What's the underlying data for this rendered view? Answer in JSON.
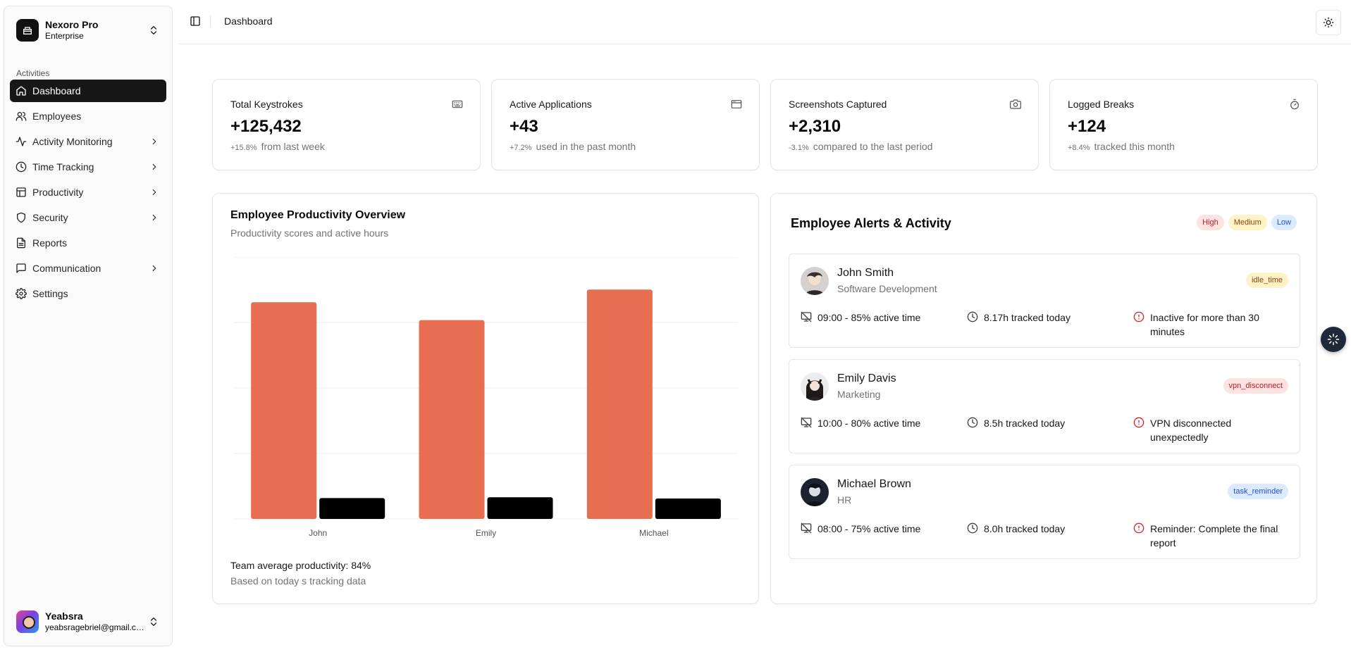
{
  "sidebar": {
    "brand": {
      "name": "Nexoro Pro",
      "plan": "Enterprise"
    },
    "section_label": "Activities",
    "items": [
      {
        "label": "Dashboard",
        "icon": "home-icon",
        "active": true
      },
      {
        "label": "Employees",
        "icon": "users-icon"
      },
      {
        "label": "Activity Monitoring",
        "icon": "activity-icon",
        "has_children": true
      },
      {
        "label": "Time Tracking",
        "icon": "clock-icon",
        "has_children": true
      },
      {
        "label": "Productivity",
        "icon": "table-icon",
        "has_children": true
      },
      {
        "label": "Security",
        "icon": "shield-icon",
        "has_children": true
      },
      {
        "label": "Reports",
        "icon": "file-text-icon"
      },
      {
        "label": "Communication",
        "icon": "message-icon",
        "has_children": true
      },
      {
        "label": "Settings",
        "icon": "gear-icon"
      }
    ],
    "user": {
      "name": "Yeabsra",
      "email": "yeabsragebriel@gmail.com"
    }
  },
  "header": {
    "title": "Dashboard"
  },
  "stats": [
    {
      "title": "Total Keystrokes",
      "value": "+125,432",
      "delta": "+15.8%",
      "note": "from last week",
      "icon": "keyboard-icon"
    },
    {
      "title": "Active Applications",
      "value": "+43",
      "delta": "+7.2%",
      "note": "used in the past month",
      "icon": "app-window-icon"
    },
    {
      "title": "Screenshots Captured",
      "value": "+2,310",
      "delta": "-3.1%",
      "note": "compared to the last period",
      "icon": "camera-icon"
    },
    {
      "title": "Logged Breaks",
      "value": "+124",
      "delta": "+8.4%",
      "note": "tracked this month",
      "icon": "timer-icon"
    }
  ],
  "productivity": {
    "title": "Employee Productivity Overview",
    "subtitle": "Productivity scores and active hours",
    "footer_main": "Team average productivity: 84%",
    "footer_sub": "Based on today s tracking data"
  },
  "chart_data": {
    "type": "bar",
    "title": "Employee Productivity Overview",
    "categories": [
      "John",
      "Emily",
      "Michael"
    ],
    "series": [
      {
        "values": [
          85,
          78,
          90
        ],
        "color": "#e76e50"
      },
      {
        "values": [
          8.17,
          8.5,
          8.0
        ],
        "color": "#000000"
      }
    ],
    "ylim": [
      0,
      100
    ],
    "grid": true
  },
  "alerts": {
    "title": "Employee Alerts & Activity",
    "legend": {
      "high": "High",
      "medium": "Medium",
      "low": "Low"
    },
    "items": [
      {
        "name": "John Smith",
        "department": "Software Development",
        "tag": "idle_time",
        "active": "09:00 - 85% active time",
        "tracked": "8.17h tracked today",
        "message": "Inactive for more than 30 minutes"
      },
      {
        "name": "Emily Davis",
        "department": "Marketing",
        "tag": "vpn_disconnect",
        "active": "10:00 - 80% active time",
        "tracked": "8.5h tracked today",
        "message": "VPN disconnected unexpectedly"
      },
      {
        "name": "Michael Brown",
        "department": "HR",
        "tag": "task_reminder",
        "active": "08:00 - 75% active time",
        "tracked": "8.0h tracked today",
        "message": "Reminder: Complete the final report"
      }
    ]
  }
}
